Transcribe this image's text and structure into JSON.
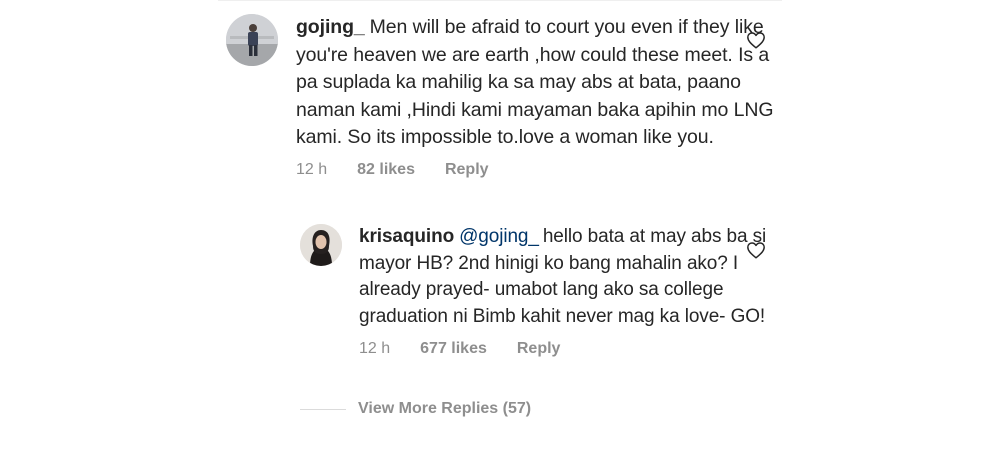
{
  "comments": [
    {
      "username": "gojing_",
      "text": "Men will be afraid to court you even if they like you're heaven we are earth ,how could these meet. Is a pa suplada ka mahilig ka sa may abs at bata, paano naman kami ,Hindi kami mayaman baka apihin mo LNG kami. So its impossible to.love a woman like you.",
      "time": "12 h",
      "likes": "82 likes",
      "reply_label": "Reply",
      "avatar_icon": "profile-photo-man-standing",
      "like_icon": "heart-outline-icon"
    }
  ],
  "replies": [
    {
      "username": "krisaquino",
      "mention": "@gojing_",
      "text": "hello bata at may abs ba si mayor HB? 2nd hinigi ko bang mahalin ako? I already prayed- umabot lang ako sa college graduation ni Bimb kahit never mag ka love- GO!",
      "time": "12 h",
      "likes": "677 likes",
      "reply_label": "Reply",
      "avatar_icon": "profile-photo-woman",
      "like_icon": "heart-outline-icon"
    }
  ],
  "view_more": {
    "label": "View More Replies (57)"
  },
  "colors": {
    "text": "#262626",
    "muted": "#8e8e8e",
    "mention": "#003569",
    "divider": "#dbdbdb"
  }
}
